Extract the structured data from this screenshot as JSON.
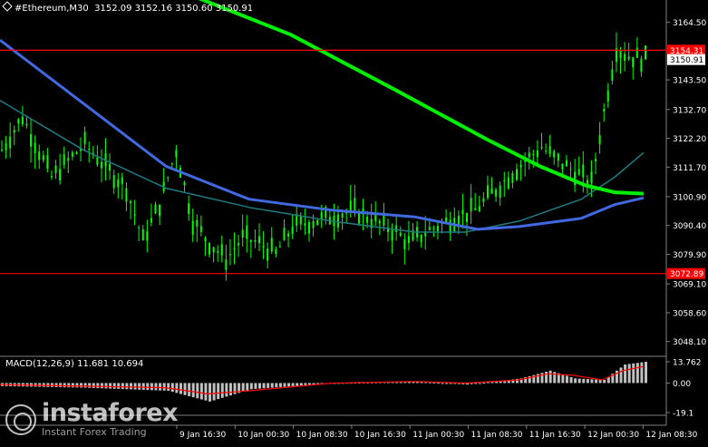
{
  "header": {
    "symbol": "#Ethereum",
    "timeframe": "M30",
    "ohlc": "3152.09 3152.16 3150.60 3150.91"
  },
  "macd": {
    "label": "MACD(12,26,9)",
    "main_value": "11.681",
    "signal_value": "10.694"
  },
  "watermark": {
    "name": "instaforex",
    "tagline": "Instant Forex Trading"
  },
  "price_axis": {
    "ticks": [
      "3164.50",
      "3143.50",
      "3132.70",
      "3122.20",
      "3111.70",
      "3100.90",
      "3090.40",
      "3079.90",
      "3069.10",
      "3058.60",
      "3048.10"
    ]
  },
  "macd_axis": {
    "ticks": [
      "13.762",
      "0.00",
      "-19.1"
    ]
  },
  "time_axis": {
    "labels": [
      "9 Jan 16:30",
      "10 Jan 00:30",
      "10 Jan 08:30",
      "10 Jan 16:30",
      "11 Jan 00:30",
      "11 Jan 08:30",
      "11 Jan 16:30",
      "12 Jan 00:30",
      "12 Jan 08:30"
    ]
  },
  "price_tags": {
    "resistance": "3154.31",
    "current": "3150.91",
    "support": "3072.89"
  },
  "colors": {
    "background": "#000000",
    "candles": "#00ff00",
    "ma_fast": "#4169e1",
    "ma_slow": "#00ee00",
    "ma_mid": "#1e7b82",
    "level_lines": "#ff0000",
    "macd_bars": "#c0c0c0",
    "macd_signal": "#ff0000",
    "axis": "#808080"
  },
  "chart_data": {
    "type": "line",
    "price_range": [
      3046,
      3168
    ],
    "levels": [
      3154.31,
      3072.89
    ],
    "ma_slow": [
      [
        0,
        3195
      ],
      [
        40,
        3178
      ],
      [
        70,
        3160
      ],
      [
        95,
        3140
      ],
      [
        117,
        3122
      ],
      [
        130,
        3112
      ],
      [
        141,
        3105
      ],
      [
        148,
        3102.5
      ],
      [
        155,
        3102
      ]
    ],
    "ma_fast": [
      [
        0,
        3158
      ],
      [
        20,
        3135
      ],
      [
        40,
        3112
      ],
      [
        60,
        3100
      ],
      [
        80,
        3096
      ],
      [
        100,
        3093.5
      ],
      [
        115,
        3089
      ],
      [
        125,
        3090
      ],
      [
        140,
        3093
      ],
      [
        148,
        3098
      ],
      [
        155,
        3100.5
      ]
    ],
    "ma_mid": [
      [
        0,
        3136
      ],
      [
        20,
        3118
      ],
      [
        40,
        3104
      ],
      [
        60,
        3097
      ],
      [
        80,
        3092
      ],
      [
        100,
        3088
      ],
      [
        112,
        3088
      ],
      [
        125,
        3092
      ],
      [
        140,
        3100
      ],
      [
        148,
        3108
      ],
      [
        155,
        3117
      ]
    ],
    "close_path": [
      [
        0,
        3118
      ],
      [
        5,
        3130
      ],
      [
        12,
        3108
      ],
      [
        20,
        3120
      ],
      [
        25,
        3112
      ],
      [
        30,
        3104
      ],
      [
        34,
        3085
      ],
      [
        38,
        3098
      ],
      [
        42,
        3118
      ],
      [
        46,
        3092
      ],
      [
        50,
        3084
      ],
      [
        54,
        3078
      ],
      [
        58,
        3086
      ],
      [
        62,
        3084
      ],
      [
        66,
        3080
      ],
      [
        70,
        3090
      ],
      [
        75,
        3092
      ],
      [
        80,
        3094
      ],
      [
        85,
        3096
      ],
      [
        90,
        3092
      ],
      [
        95,
        3088
      ],
      [
        98,
        3084
      ],
      [
        102,
        3088
      ],
      [
        106,
        3091
      ],
      [
        110,
        3094
      ],
      [
        114,
        3096
      ],
      [
        118,
        3102
      ],
      [
        122,
        3108
      ],
      [
        126,
        3114
      ],
      [
        130,
        3119
      ],
      [
        134,
        3114
      ],
      [
        138,
        3110
      ],
      [
        142,
        3106
      ],
      [
        145,
        3132
      ],
      [
        148,
        3155
      ],
      [
        151,
        3152
      ],
      [
        155,
        3151
      ]
    ],
    "macd_main": [
      [
        0,
        -2
      ],
      [
        20,
        -3
      ],
      [
        40,
        -5
      ],
      [
        50,
        -12
      ],
      [
        60,
        -4
      ],
      [
        80,
        0
      ],
      [
        100,
        1
      ],
      [
        112,
        -1
      ],
      [
        125,
        3
      ],
      [
        132,
        8
      ],
      [
        138,
        3
      ],
      [
        145,
        2
      ],
      [
        150,
        12
      ],
      [
        155,
        13.76
      ]
    ],
    "macd_signal": [
      [
        0,
        -1
      ],
      [
        20,
        -2
      ],
      [
        40,
        -3
      ],
      [
        50,
        -7
      ],
      [
        60,
        -5
      ],
      [
        80,
        0
      ],
      [
        100,
        1
      ],
      [
        112,
        0
      ],
      [
        125,
        2
      ],
      [
        132,
        6
      ],
      [
        138,
        5
      ],
      [
        145,
        2
      ],
      [
        150,
        8
      ],
      [
        155,
        10.69
      ]
    ],
    "macd_range": [
      -19.1,
      13.762
    ]
  }
}
